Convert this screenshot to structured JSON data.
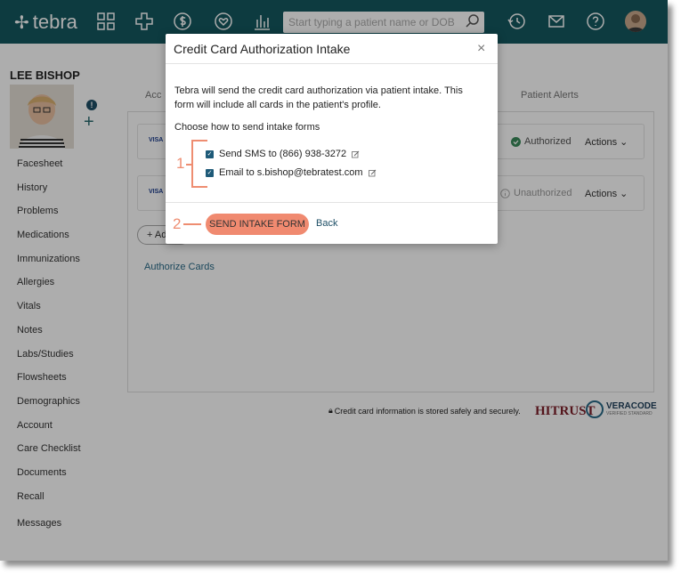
{
  "header": {
    "brand": "tebra",
    "search_placeholder": "Start typing a patient name or DOB"
  },
  "patient": {
    "name": "LEE BISHOP"
  },
  "sidebar": {
    "items": [
      {
        "label": "Facesheet"
      },
      {
        "label": "History"
      },
      {
        "label": "Problems"
      },
      {
        "label": "Medications"
      },
      {
        "label": "Immunizations"
      },
      {
        "label": "Allergies"
      },
      {
        "label": "Vitals"
      },
      {
        "label": "Notes"
      },
      {
        "label": "Labs/Studies"
      },
      {
        "label": "Flowsheets"
      },
      {
        "label": "Demographics"
      },
      {
        "label": "Account"
      },
      {
        "label": "Care Checklist"
      },
      {
        "label": "Documents"
      },
      {
        "label": "Recall"
      },
      {
        "label": "Messages"
      }
    ]
  },
  "main": {
    "tab_account": "Acc",
    "tab_alerts": "Patient Alerts",
    "cards": [
      {
        "brand": "VISA",
        "status": "Authorized",
        "actions": "Actions"
      },
      {
        "brand": "VISA",
        "status": "Unauthorized",
        "actions": "Actions"
      }
    ],
    "add_button": "+ Ad",
    "authorize_link": "Authorize Cards",
    "secure_note": "Credit card information is stored safely and securely.",
    "hitrust": "HITRUST",
    "veracode": "VERACODE",
    "veracode_sub": "VERIFIED STANDARD"
  },
  "modal": {
    "title": "Credit Card Authorization Intake",
    "close": "×",
    "description": "Tebra will send the credit card authorization via patient intake. This form will include all cards in the patient's profile.",
    "choose_label": "Choose how to send intake forms",
    "options": [
      {
        "label": "Send SMS to (866) 938-3272",
        "checked": true
      },
      {
        "label": "Email to s.bishop@tebratest.com",
        "checked": true
      }
    ],
    "send_button": "SEND INTAKE FORM",
    "back_link": "Back"
  },
  "callouts": {
    "one": "1",
    "two": "2"
  },
  "colors": {
    "topbar": "#14575f",
    "accent": "#f08a70",
    "callout": "#ee8d71",
    "link": "#2a6b88"
  }
}
